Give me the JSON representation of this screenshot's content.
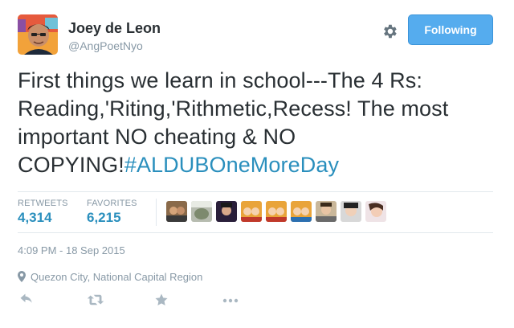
{
  "user": {
    "display_name": "Joey de Leon",
    "handle": "@AngPoetNyo"
  },
  "follow_button": {
    "label": "Following"
  },
  "tweet": {
    "text": "First things we learn in school---The 4 Rs: Reading,'Riting,'Rithmetic,Recess! The most important NO cheating & NO COPYING!",
    "hashtag": "#ALDUBOneMoreDay"
  },
  "stats": {
    "retweets_label": "RETWEETS",
    "retweets_value": "4,314",
    "favorites_label": "FAVORITES",
    "favorites_value": "6,215"
  },
  "timestamp": "4:09 PM - 18 Sep 2015",
  "location": "Quezon City, National Capital Region",
  "icons": {
    "settings": "gear-icon",
    "location": "map-pin-icon",
    "reply": "reply-icon",
    "retweet": "retweet-icon",
    "favorite": "star-icon",
    "more": "more-icon"
  },
  "colors": {
    "accent": "#55acee",
    "link": "#2a8fbd",
    "muted": "#8899a6",
    "text": "#292f33"
  }
}
